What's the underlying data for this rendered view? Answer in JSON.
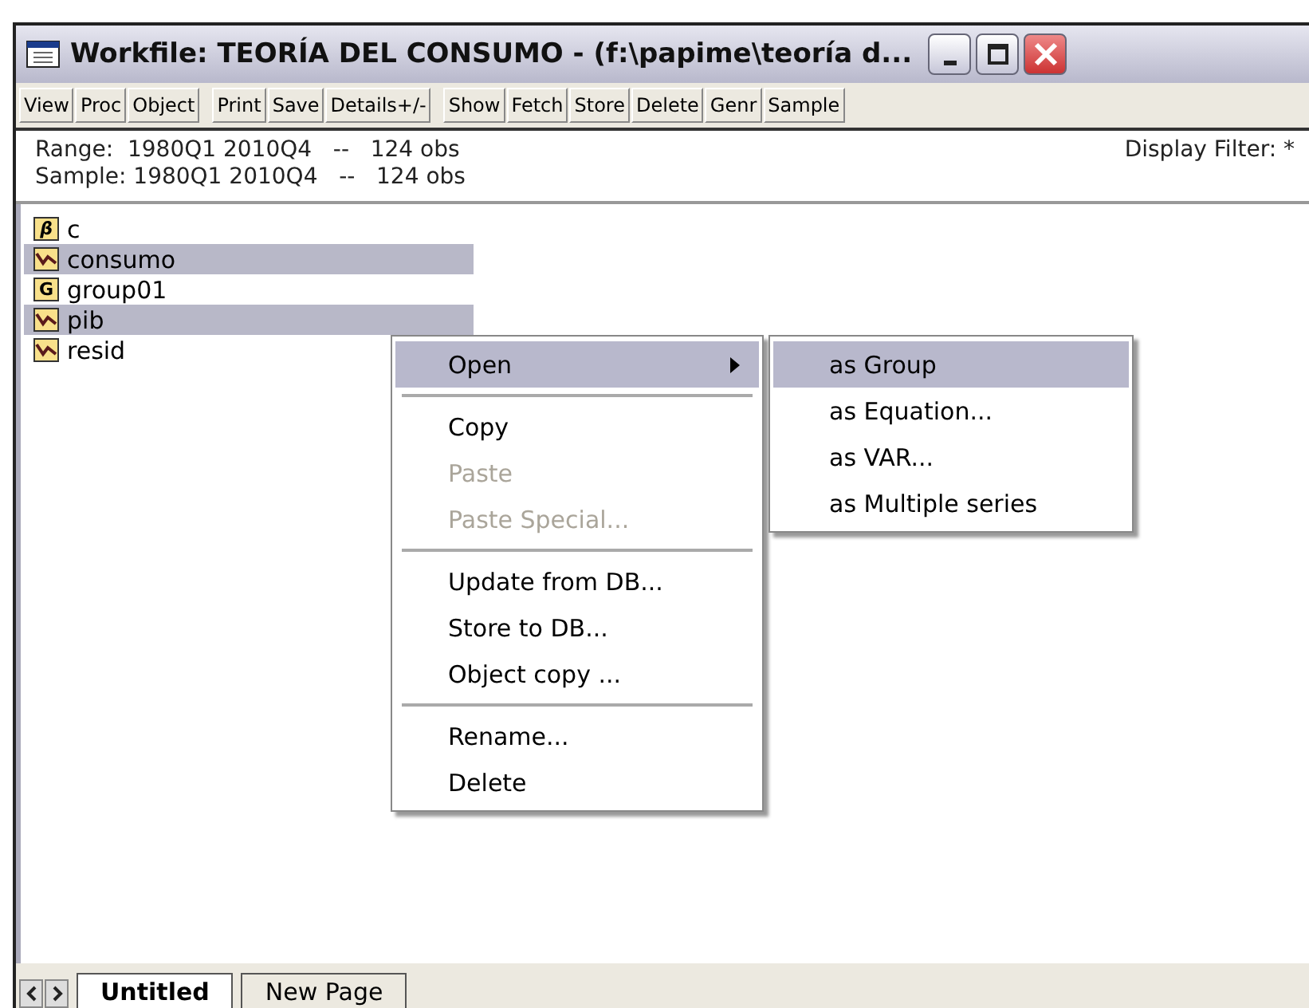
{
  "window": {
    "title": "Workfile: TEORÍA DEL CONSUMO - (f:\\papime\\teoría d..."
  },
  "toolbar_groups": [
    [
      "View",
      "Proc",
      "Object"
    ],
    [
      "Print",
      "Save",
      "Details+/-"
    ],
    [
      "Show",
      "Fetch",
      "Store",
      "Delete",
      "Genr",
      "Sample"
    ]
  ],
  "info": {
    "range": "Range:  1980Q1 2010Q4   --   124 obs",
    "sample": "Sample: 1980Q1 2010Q4   --   124 obs",
    "filter": "Display Filter: *"
  },
  "objects": [
    {
      "kind": "coefficient",
      "icon_text": "β",
      "name": "c",
      "selected": false
    },
    {
      "kind": "series",
      "name": "consumo",
      "selected": true
    },
    {
      "kind": "group",
      "icon_text": "G",
      "name": "group01",
      "selected": false
    },
    {
      "kind": "series",
      "name": "pib",
      "selected": true
    },
    {
      "kind": "series",
      "name": "resid",
      "selected": false
    }
  ],
  "context_menu": {
    "sections": [
      [
        {
          "label": "Open",
          "selected": true,
          "disabled": false,
          "submenu": true
        }
      ],
      [
        {
          "label": "Copy",
          "selected": false,
          "disabled": false,
          "submenu": false
        },
        {
          "label": "Paste",
          "selected": false,
          "disabled": true,
          "submenu": false
        },
        {
          "label": "Paste Special...",
          "selected": false,
          "disabled": true,
          "submenu": false
        }
      ],
      [
        {
          "label": "Update from DB...",
          "selected": false,
          "disabled": false,
          "submenu": false
        },
        {
          "label": "Store to DB...",
          "selected": false,
          "disabled": false,
          "submenu": false
        },
        {
          "label": "Object copy ...",
          "selected": false,
          "disabled": false,
          "submenu": false
        }
      ],
      [
        {
          "label": "Rename...",
          "selected": false,
          "disabled": false,
          "submenu": false
        },
        {
          "label": "Delete",
          "selected": false,
          "disabled": false,
          "submenu": false
        }
      ]
    ]
  },
  "submenu": [
    {
      "label": "as Group",
      "selected": true
    },
    {
      "label": "as Equation...",
      "selected": false
    },
    {
      "label": "as VAR...",
      "selected": false
    },
    {
      "label": "as Multiple series",
      "selected": false
    }
  ],
  "page_tabs": [
    {
      "label": "Untitled",
      "selected": true
    },
    {
      "label": "New Page",
      "selected": false
    }
  ]
}
